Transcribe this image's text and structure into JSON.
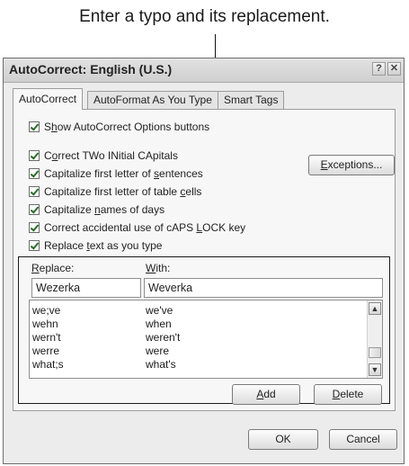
{
  "callout": {
    "text": "Enter a typo and its replacement."
  },
  "window": {
    "title": "AutoCorrect: English (U.S.)",
    "help_glyph": "?",
    "close_glyph": "✕"
  },
  "tabs": [
    {
      "label": "AutoCorrect",
      "active": true
    },
    {
      "label": "AutoFormat As You Type",
      "active": false
    },
    {
      "label": "Smart Tags",
      "active": false
    }
  ],
  "options": {
    "show_buttons": {
      "pre": "",
      "key": "h",
      "post": "ow AutoCorrect Options buttons",
      "prefix": "S",
      "checked": true
    },
    "correct_two_initial": {
      "prefix": "C",
      "key": "o",
      "post": "rrect TWo INitial CApitals",
      "checked": true
    },
    "capitalize_sentences": {
      "prefix": "Capitalize first letter of ",
      "key": "s",
      "post": "entences",
      "checked": true
    },
    "capitalize_table_cells": {
      "prefix": "Capitalize first letter of table ",
      "key": "c",
      "post": "ells",
      "checked": true
    },
    "capitalize_days": {
      "prefix": "Capitalize ",
      "key": "n",
      "post": "ames of days",
      "checked": true
    },
    "caps_lock": {
      "prefix": "Correct accidental use of cAPS ",
      "key": "L",
      "post": "OCK key",
      "checked": true
    },
    "replace_text": {
      "prefix": "Replace ",
      "key": "t",
      "post": "ext as you type",
      "checked": true
    }
  },
  "buttons": {
    "exceptions": {
      "key": "E",
      "rest": "xceptions..."
    },
    "add": {
      "key": "A",
      "rest": "dd"
    },
    "delete": {
      "key": "D",
      "rest": "elete"
    },
    "ok": "OK",
    "cancel": "Cancel"
  },
  "replace": {
    "replace_label_key": "R",
    "replace_label_rest": "eplace:",
    "with_label_key": "W",
    "with_label_rest": "ith:",
    "replace_value": "Wezerka",
    "with_value": "Weverka"
  },
  "entries": [
    {
      "replace": "we;ve",
      "with": "we've"
    },
    {
      "replace": "wehn",
      "with": "when"
    },
    {
      "replace": "wern't",
      "with": "weren't"
    },
    {
      "replace": "werre",
      "with": "were"
    },
    {
      "replace": "what;s",
      "with": "what's"
    }
  ],
  "scroll": {
    "up_glyph": "▲",
    "down_glyph": "▼"
  }
}
